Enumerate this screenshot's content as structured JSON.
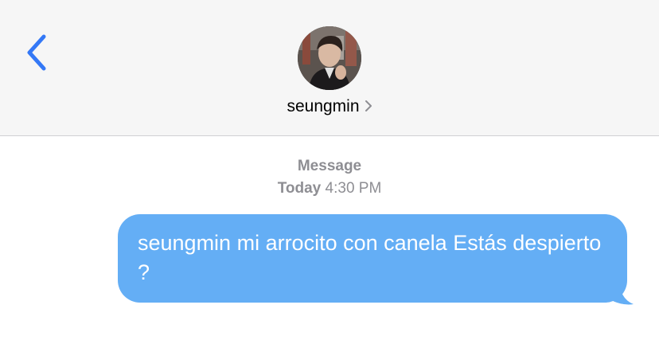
{
  "header": {
    "back_icon": "chevron-left-icon",
    "contact_name": "seungmin",
    "contact_chevron_icon": "chevron-right-icon",
    "accent_color": "#3478f6"
  },
  "thread": {
    "service_label": "Message",
    "day_label": "Today",
    "time_label": "4:30 PM"
  },
  "messages": [
    {
      "direction": "outgoing",
      "text": "seungmin mi arrocito con canela Estás despierto ?",
      "bubble_color": "#64aef5"
    }
  ]
}
